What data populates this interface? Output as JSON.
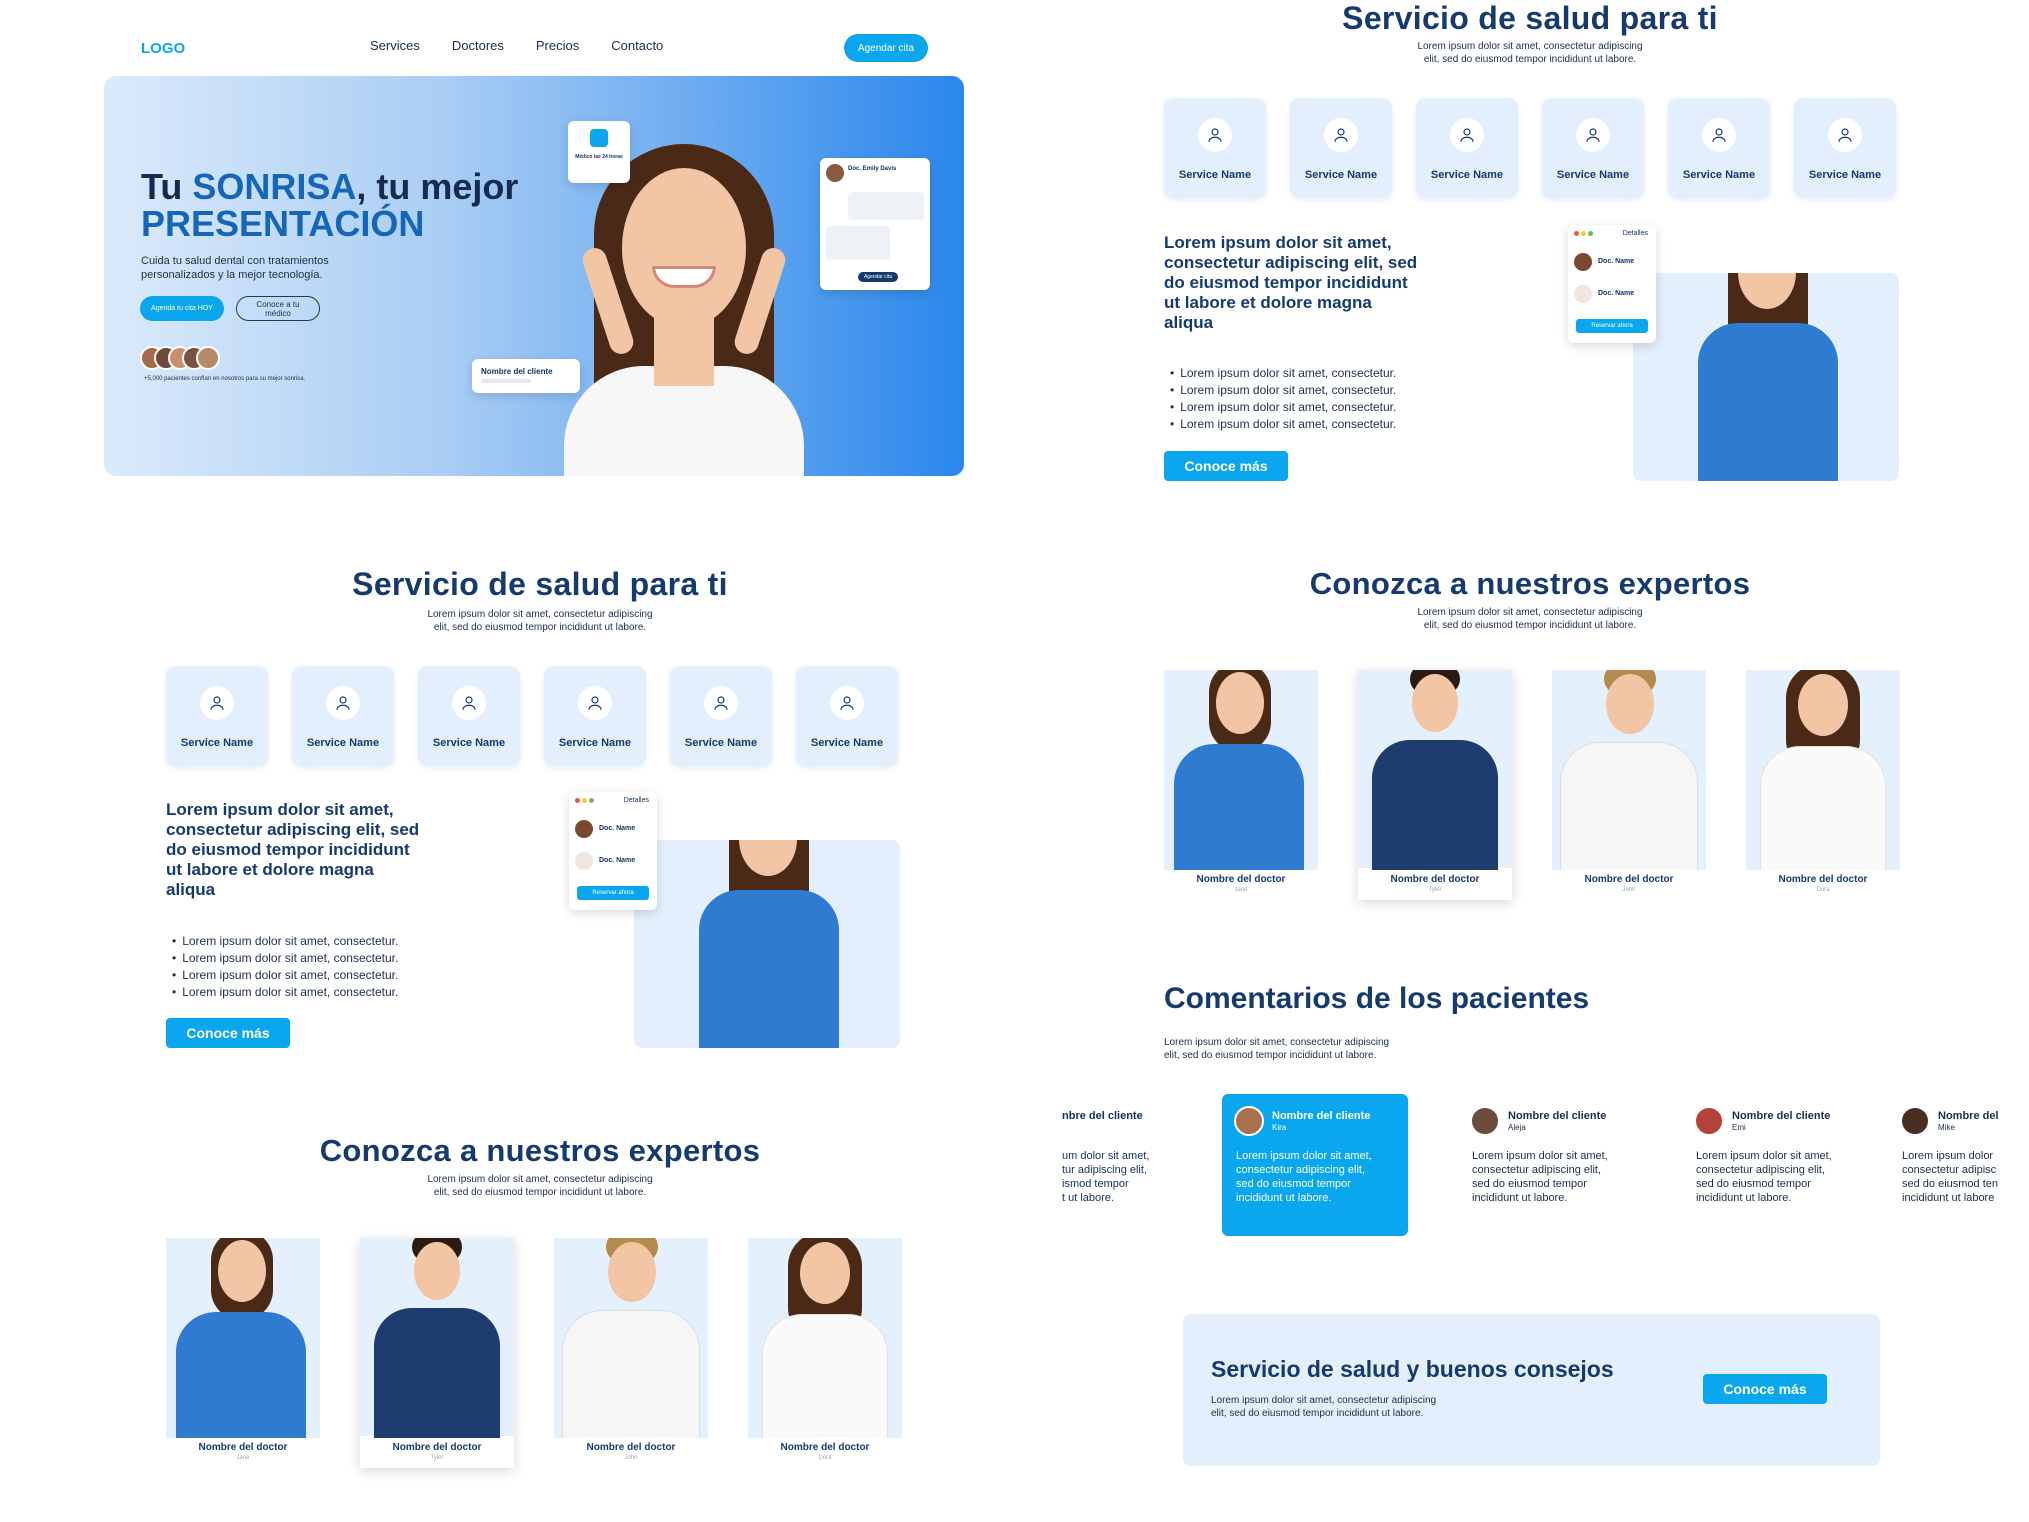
{
  "colors": {
    "accent": "#0aa7ef",
    "navy": "#163a6e",
    "light_bg": "#e3effc",
    "hero_gradient_start": "#dbeafb",
    "hero_gradient_end": "#2a87ec"
  },
  "nav": {
    "logo": "LOGO",
    "links": [
      "Services",
      "Doctores",
      "Precios",
      "Contacto"
    ],
    "cta": "Agendar cita"
  },
  "hero": {
    "title_1": "Tu ",
    "title_highlight": "SONRISA",
    "title_2": ", tu mejor",
    "title_3": "PRESENTACIÓN",
    "desc_1": "Cuida tu salud dental con tratamientos",
    "desc_2": "personalizados y la mejor tecnología.",
    "primary_btn": "Agenda tu cita HOY",
    "secondary_btn_1": "Conoce a tu",
    "secondary_btn_2": "médico",
    "trust_text": "+5,000 pacientes confían en nosotros para su mejor sonrisa.",
    "card_24h": "Médico las 24 horas",
    "chat_name": "Doc. Emily Davis",
    "chat_btn": "Agendar cita",
    "client_card": "Nombre del cliente"
  },
  "services_title": "Servicio de salud para ti",
  "services_sub_1": "Lorem ipsum dolor sit amet, consectetur adipiscing",
  "services_sub_2": "elit, sed do eiusmod tempor incididunt ut labore.",
  "service_items": [
    "Service Name",
    "Service Name",
    "Service Name",
    "Service Name",
    "Service Name",
    "Service Name"
  ],
  "feature": {
    "heading_lines": [
      "Lorem ipsum dolor sit amet,",
      "consectetur adipiscing elit, sed",
      "do eiusmod tempor incididunt",
      "ut labore et dolore magna",
      "aliqua"
    ],
    "bullets": [
      "Lorem ipsum dolor sit amet, consectetur.",
      "Lorem ipsum dolor sit amet, consectetur.",
      "Lorem ipsum dolor sit amet, consectetur.",
      "Lorem ipsum dolor sit amet, consectetur."
    ],
    "btn": "Conoce más",
    "details_label": "Detalles",
    "doc_1": "Doc. Name",
    "doc_2": "Doc. Name",
    "reserve": "Reservar ahora"
  },
  "experts": {
    "title": "Conozca a nuestros expertos",
    "doctors": [
      {
        "name": "Nombre del doctor",
        "sub": "Jane"
      },
      {
        "name": "Nombre del doctor",
        "sub": "Tyler"
      },
      {
        "name": "Nombre del doctor",
        "sub": "John"
      },
      {
        "name": "Nombre del doctor",
        "sub": "Dora"
      }
    ]
  },
  "comments": {
    "title": "Comentarios de los pacientes",
    "items": [
      {
        "name": "nbre del cliente",
        "sub": "",
        "text_1": "um dolor sit amet,",
        "text_2": "tur adipiscing elit,",
        "text_3": "ismod tempor",
        "text_4": "t ut labore."
      },
      {
        "name": "Nombre del cliente",
        "sub": "Kira",
        "text_1": "Lorem ipsum dolor sit amet,",
        "text_2": "consectetur adipiscing elit,",
        "text_3": "sed do eiusmod tempor",
        "text_4": "incididunt ut labore."
      },
      {
        "name": "Nombre del cliente",
        "sub": "Aleja",
        "text_1": "Lorem ipsum dolor sit amet,",
        "text_2": "consectetur adipiscing elit,",
        "text_3": "sed do eiusmod tempor",
        "text_4": "incididunt ut labore."
      },
      {
        "name": "Nombre del cliente",
        "sub": "Emi",
        "text_1": "Lorem ipsum dolor sit amet,",
        "text_2": "consectetur adipiscing elit,",
        "text_3": "sed do eiusmod tempor",
        "text_4": "incididunt ut labore."
      },
      {
        "name": "Nombre del c",
        "sub": "Mike",
        "text_1": "Lorem ipsum dolor",
        "text_2": "consectetur adipisc",
        "text_3": "sed do eiusmod ten",
        "text_4": "incididunt ut labore"
      }
    ]
  },
  "cta_banner": {
    "title": "Servicio de salud y buenos consejos",
    "sub_1": "Lorem ipsum dolor sit amet, consectetur adipiscing",
    "sub_2": "elit, sed do eiusmod tempor incididunt ut labore.",
    "btn": "Conoce más"
  }
}
